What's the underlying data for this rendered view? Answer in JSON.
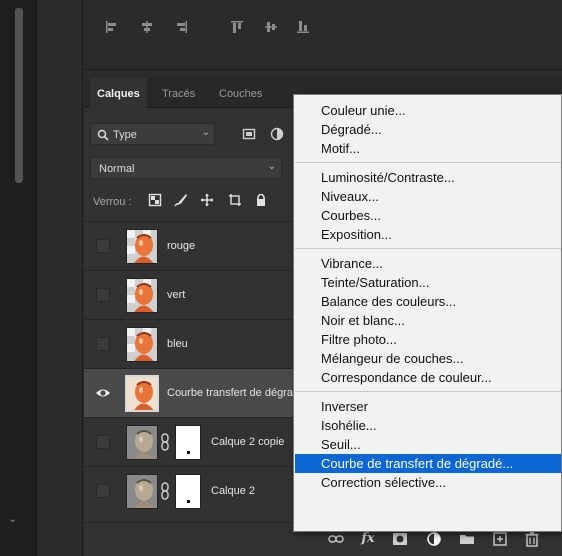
{
  "tabs": [
    "Calques",
    "Tracés",
    "Couches"
  ],
  "filter": {
    "label": "Type"
  },
  "blend_mode": {
    "value": "Normal"
  },
  "lock": {
    "label": "Verrou :"
  },
  "layers": [
    {
      "name": "rouge",
      "visible": false
    },
    {
      "name": "vert",
      "visible": false
    },
    {
      "name": "bleu",
      "visible": false
    },
    {
      "name": "Courbe transfert de dégradé",
      "visible": true,
      "selected": true
    },
    {
      "name": "Calque 2 copie",
      "visible": false
    },
    {
      "name": "Calque 2",
      "visible": false
    }
  ],
  "bottom_bar": {
    "fx_label": "fx"
  },
  "menu": {
    "groups": [
      [
        "Couleur unie...",
        "Dégradé...",
        "Motif..."
      ],
      [
        "Luminosité/Contraste...",
        "Niveaux...",
        "Courbes...",
        "Exposition..."
      ],
      [
        "Vibrance...",
        "Teinte/Saturation...",
        "Balance des couleurs...",
        "Noir et blanc...",
        "Filtre photo...",
        "Mélangeur de couches...",
        "Correspondance de couleur..."
      ],
      [
        "Inverser",
        "Isohélie...",
        "Seuil...",
        "Courbe de transfert de dégradé...",
        "Correction sélective..."
      ]
    ],
    "highlighted": "Courbe de transfert de dégradé..."
  },
  "colors": {
    "menu_highlight": "#0a66d4",
    "panel_bg": "#323232",
    "selected_layer_bg": "#4a4a4a"
  }
}
